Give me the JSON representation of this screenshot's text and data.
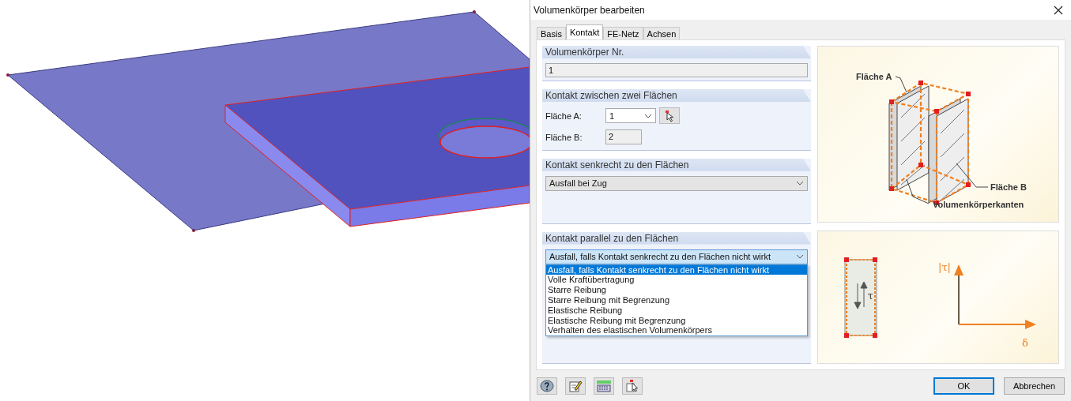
{
  "window": {
    "title": "Volumenkörper bearbeiten"
  },
  "tabs": [
    {
      "label": "Basis",
      "selected": false
    },
    {
      "label": "Kontakt",
      "selected": true
    },
    {
      "label": "FE-Netz",
      "selected": false
    },
    {
      "label": "Achsen",
      "selected": false
    }
  ],
  "solid_number": {
    "title": "Volumenkörper Nr.",
    "value": "1"
  },
  "contact_surfaces": {
    "title": "Kontakt zwischen zwei Flächen",
    "surface_a": {
      "label": "Fläche A:",
      "value": "1"
    },
    "surface_b": {
      "label": "Fläche B:",
      "value": "2"
    }
  },
  "contact_perpendicular": {
    "title": "Kontakt senkrecht zu den Flächen",
    "value": "Ausfall bei Zug"
  },
  "contact_parallel": {
    "title": "Kontakt parallel zu den Flächen",
    "value": "Ausfall, falls Kontakt senkrecht zu den Flächen nicht wirkt",
    "expanded": true,
    "options": [
      {
        "label": "Ausfall, falls Kontakt senkrecht zu den Flächen nicht wirkt",
        "selected": true
      },
      {
        "label": "Volle Kraftübertragung",
        "selected": false
      },
      {
        "label": "Starre Reibung",
        "selected": false
      },
      {
        "label": "Starre Reibung mit Begrenzung",
        "selected": false
      },
      {
        "label": "Elastische Reibung",
        "selected": false
      },
      {
        "label": "Elastische Reibung mit Begrenzung",
        "selected": false
      },
      {
        "label": "Verhalten des elastischen Volumenkörpers",
        "selected": false
      }
    ]
  },
  "diagram_top": {
    "label_a": "Fläche A",
    "label_b": "Fläche B",
    "label_edges": "Volumenkörperkanten"
  },
  "diagram_bottom": {
    "shear": "τ",
    "y_axis": "|τ|",
    "x_axis": "δ"
  },
  "buttons": [
    {
      "label": "OK",
      "default": true
    },
    {
      "label": "Abbrechen",
      "default": false
    }
  ]
}
